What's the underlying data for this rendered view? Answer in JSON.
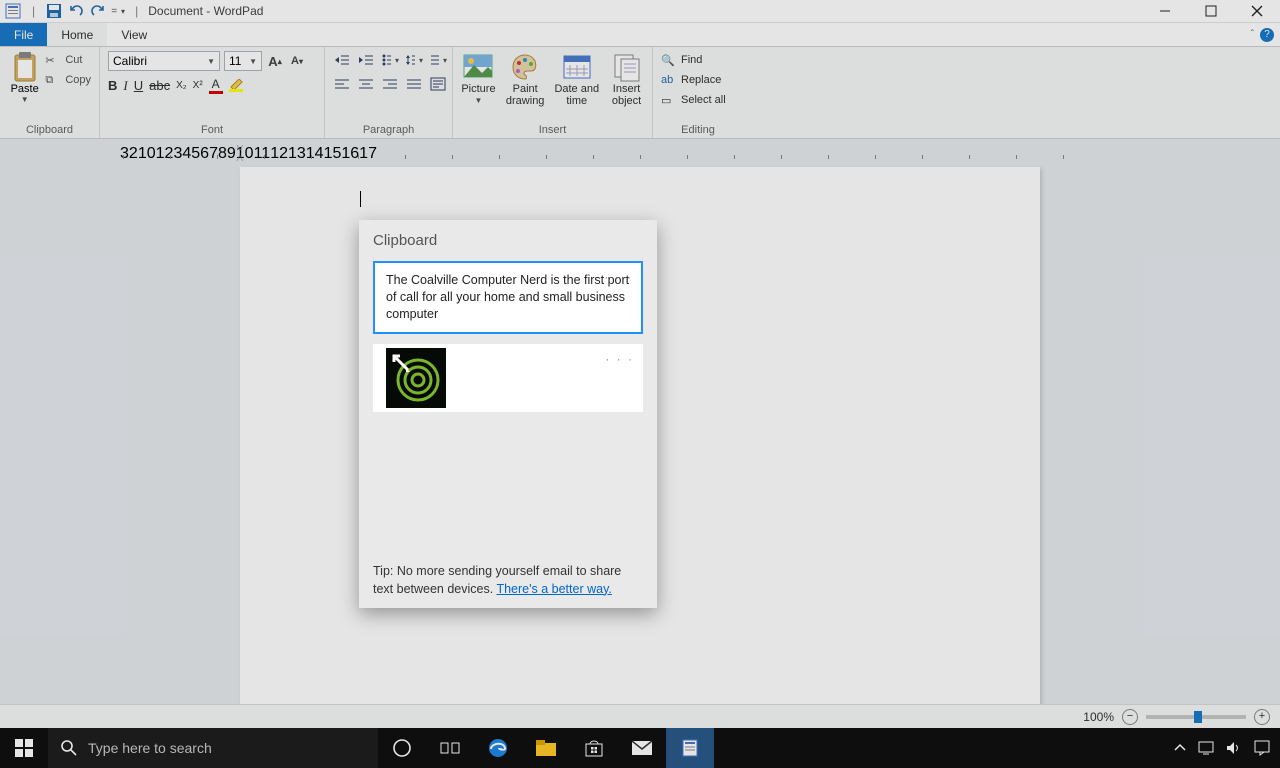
{
  "title": "Document - WordPad",
  "tabs": {
    "file": "File",
    "home": "Home",
    "view": "View"
  },
  "ribbon": {
    "clipboard": {
      "paste": "Paste",
      "cut": "Cut",
      "copy": "Copy",
      "label": "Clipboard"
    },
    "font": {
      "name": "Calibri",
      "size": "11",
      "label": "Font"
    },
    "paragraph": {
      "label": "Paragraph"
    },
    "insert": {
      "picture": "Picture",
      "paint": "Paint\ndrawing",
      "datetime": "Date and\ntime",
      "object": "Insert\nobject",
      "label": "Insert"
    },
    "editing": {
      "find": "Find",
      "replace": "Replace",
      "selectall": "Select all",
      "label": "Editing"
    }
  },
  "clipboard_panel": {
    "title": "Clipboard",
    "items": [
      {
        "type": "text",
        "text": "The Coalville Computer Nerd is the first port of call for all your home and small business computer"
      },
      {
        "type": "image"
      }
    ],
    "tip_prefix": "Tip: No more sending yourself email to share text between devices.  ",
    "tip_link": "There's a better way."
  },
  "zoom": {
    "percent": "100%"
  },
  "taskbar": {
    "search_placeholder": "Type here to search"
  }
}
